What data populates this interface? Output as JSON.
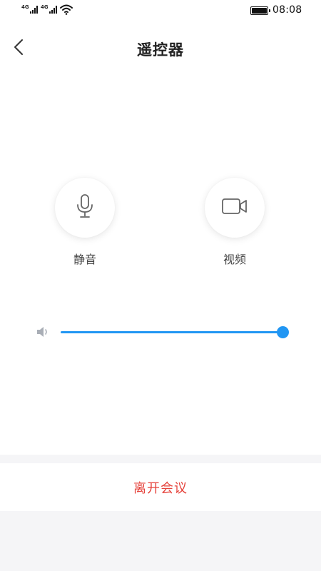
{
  "status_bar": {
    "network_1": "4G",
    "network_2": "4G",
    "time": "08:08",
    "icons": [
      "signal-icon",
      "signal-icon",
      "wifi-icon",
      "battery-icon"
    ]
  },
  "header": {
    "title": "遥控器",
    "back_icon": "chevron-left-icon"
  },
  "controls": {
    "mute": {
      "label": "静音",
      "icon": "microphone-icon"
    },
    "video": {
      "label": "视频",
      "icon": "video-camera-icon"
    }
  },
  "volume": {
    "icon": "speaker-icon",
    "level": 1.0,
    "accent_color": "#2196f3"
  },
  "footer": {
    "leave_label": "离开会议",
    "leave_color": "#e5413a"
  }
}
